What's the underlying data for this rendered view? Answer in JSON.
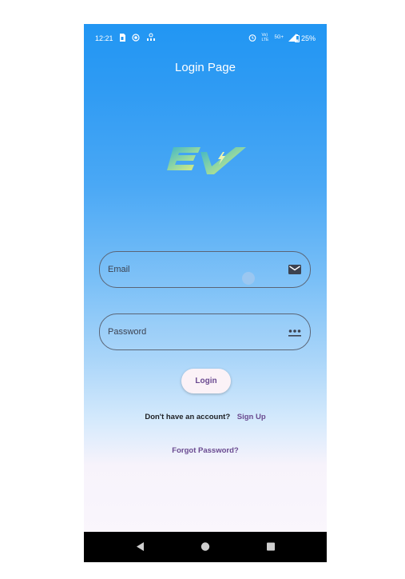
{
  "statusbar": {
    "time": "12:21",
    "battery": "25%",
    "network": "5G+",
    "volte": "Vo) LTE"
  },
  "page": {
    "title": "Login Page",
    "logo_text": "EV"
  },
  "form": {
    "email_placeholder": "Email",
    "password_placeholder": "Password",
    "login_label": "Login",
    "signup_prompt": "Don't have an account?",
    "signup_link": "Sign Up",
    "forgot_link": "Forgot Password?"
  },
  "icons": {
    "email": "mail-icon",
    "password": "password-dots-icon",
    "back": "back-icon",
    "home": "home-icon",
    "recents": "recents-icon"
  },
  "colors": {
    "accent": "#6a4a90",
    "gradient_top": "#2196f3",
    "gradient_bottom": "#fbf7fd"
  }
}
